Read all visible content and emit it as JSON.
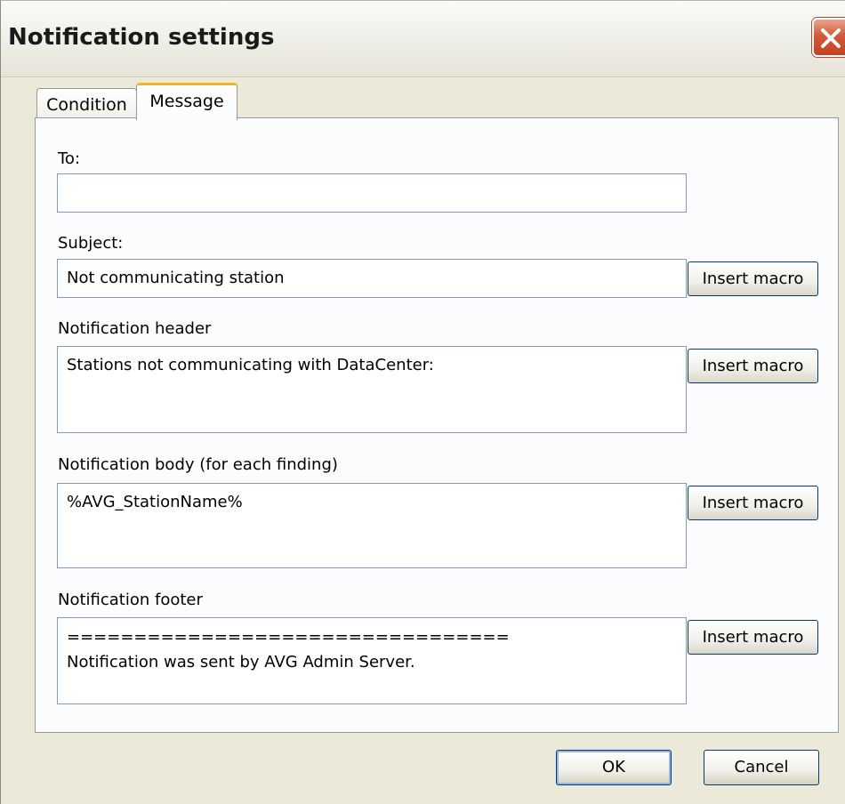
{
  "window": {
    "title": "Notification settings"
  },
  "tabs": [
    {
      "label": "Condition",
      "active": false
    },
    {
      "label": "Message",
      "active": true
    }
  ],
  "form": {
    "to_label": "To:",
    "to_value": "",
    "subject_label": "Subject:",
    "subject_value": "Not communicating station",
    "header_label": "Notification header",
    "header_value": "Stations not communicating with DataCenter:",
    "body_label": "Notification body (for each finding)",
    "body_value": "%AVG_StationName%",
    "footer_label": "Notification footer",
    "footer_value": "=================================\nNotification was sent by AVG Admin Server.",
    "insert_macro_label": "Insert macro"
  },
  "buttons": {
    "ok": "OK",
    "cancel": "Cancel"
  },
  "icons": {
    "close": "close-icon"
  },
  "colors": {
    "dialog_bg": "#ece9d8",
    "active_tab_accent": "#f4b42a",
    "close_button": "#d4593a",
    "input_border": "#7f9db9",
    "button_border": "#003c74"
  }
}
